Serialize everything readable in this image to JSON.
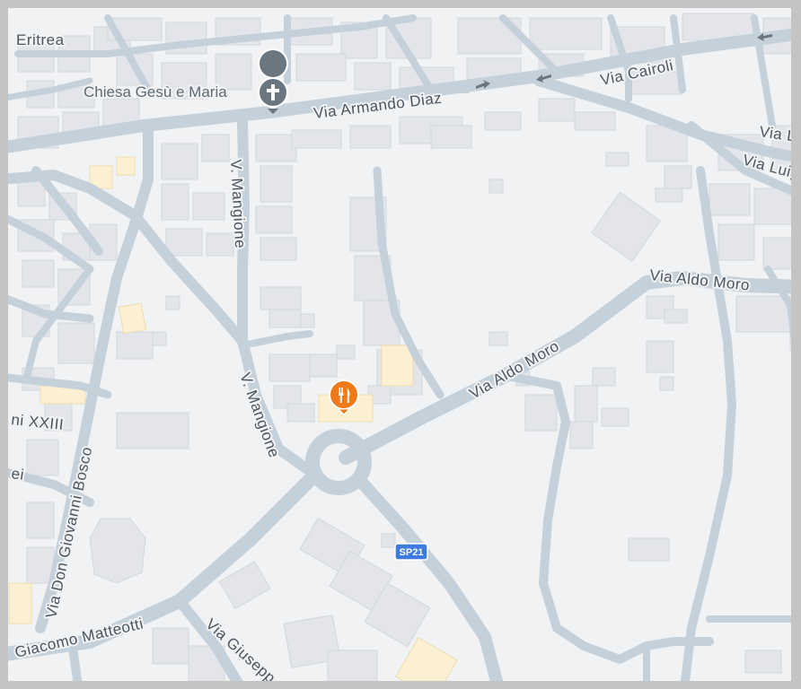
{
  "map": {
    "colors": {
      "land": "#f1f2f4",
      "road": "#c4d0da",
      "building": "#e3e5ea",
      "building_outline": "#d3d6dc",
      "highlight_building": "#fbf0d2",
      "route_shield": "#3f7ae0",
      "restaurant_pin": "#f07a1a",
      "church_pin": "#6a7680"
    },
    "road_labels": {
      "via_armando_diaz": "Via Armando Diaz",
      "via_cairoli": "Via Cairoli",
      "via_l_top": "Via L",
      "via_luig": "Via Luig",
      "via_aldo_moro_upper": "Via Aldo Moro",
      "via_aldo_moro_lower": "Via Aldo Moro",
      "v_mangione_upper": "V. Mangione",
      "v_mangione_lower": "V. Mangione",
      "via_don_giovanni_bosco": "Via Don Giovanni Bosco",
      "giacomo_matteotti": "Giacomo Matteotti",
      "via_giusepp": "Via Giusepp",
      "eritrea": "Eritrea",
      "ni_xxiii": "ni XXIII",
      "ei": "ei"
    },
    "pois": {
      "church_name": "Chiesa Gesù e Maria",
      "church_icon": "church-cross-icon",
      "restaurant_icon": "restaurant-icon"
    },
    "route_shield": {
      "label": "SP21"
    }
  }
}
